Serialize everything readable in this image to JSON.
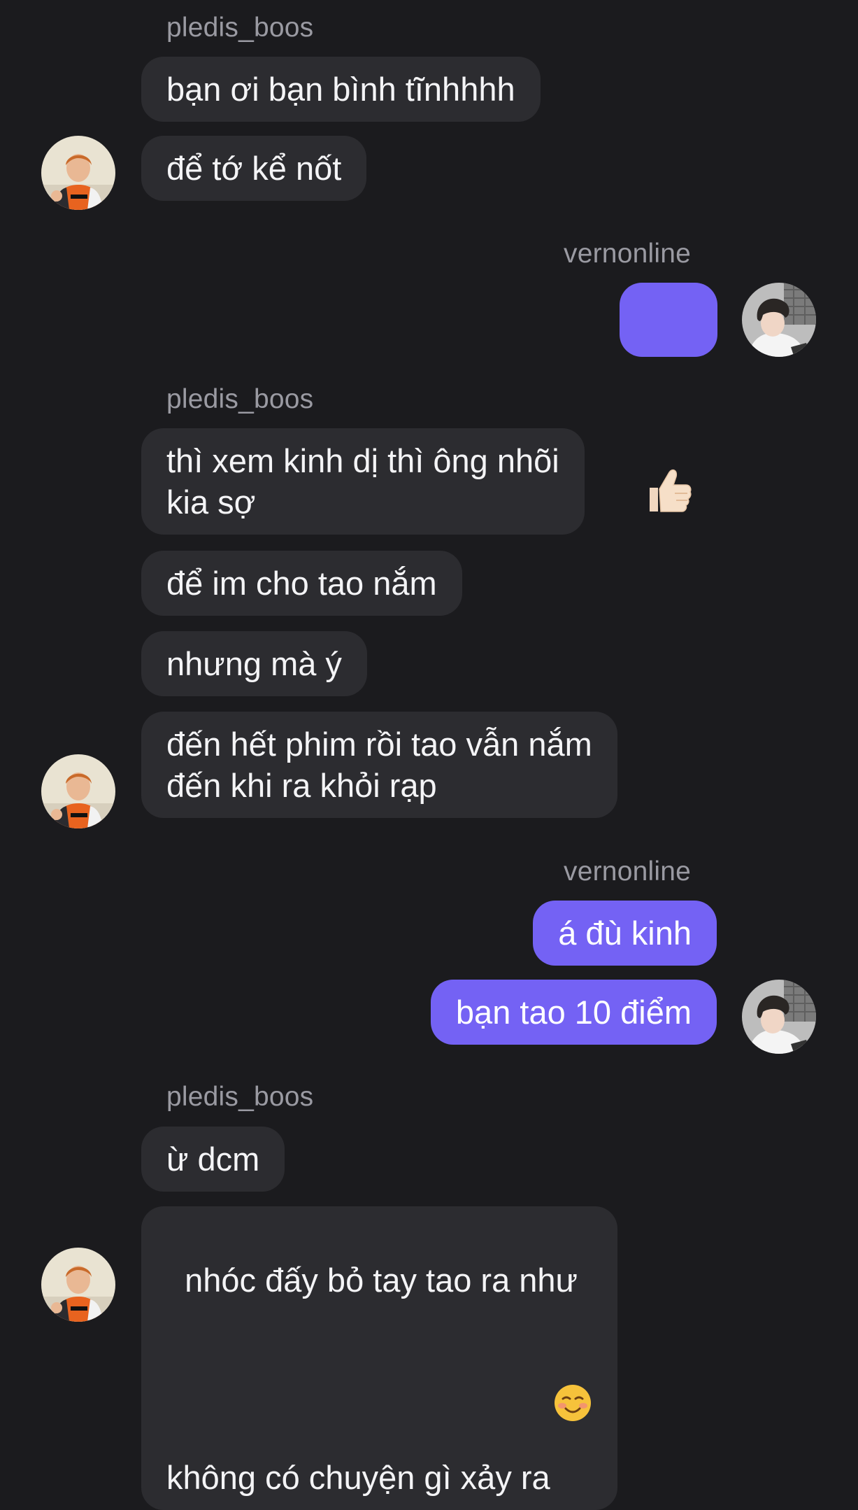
{
  "users": {
    "other": {
      "username": "pledis_boos",
      "avatar_icon": "avatar-orange-jersey-icon"
    },
    "me": {
      "username": "vernonline",
      "avatar_icon": "avatar-dark-hair-icon"
    }
  },
  "colors": {
    "background": "#1b1b1e",
    "incoming_bubble": "#2c2c30",
    "outgoing_bubble": "#7462f4",
    "username": "#9a9aa2"
  },
  "groups": [
    {
      "sender": "pledis_boos",
      "messages": [
        "bạn ơi bạn bình tĩnhhhh",
        "để tớ kể nốt"
      ]
    },
    {
      "sender": "vernonline",
      "messages": [
        {
          "emoji": "thumbs-up-icon"
        }
      ]
    },
    {
      "sender": "pledis_boos",
      "messages": [
        "thì xem kinh dị thì ông nhõi\nkia sợ",
        "để im cho tao nắm",
        "nhưng mà ý",
        "đến hết phim rồi tao vẫn nắm\nđến khi ra khỏi rạp"
      ]
    },
    {
      "sender": "vernonline",
      "messages": [
        "á đù kinh",
        "bạn tao 10 điểm"
      ]
    },
    {
      "sender": "pledis_boos",
      "messages": [
        "ừ dcm",
        {
          "text": "nhóc đấy bỏ tay tao ra như\nkhông có chuyện gì xảy ra",
          "trailing_emoji": "smiling-face-icon"
        }
      ]
    }
  ]
}
